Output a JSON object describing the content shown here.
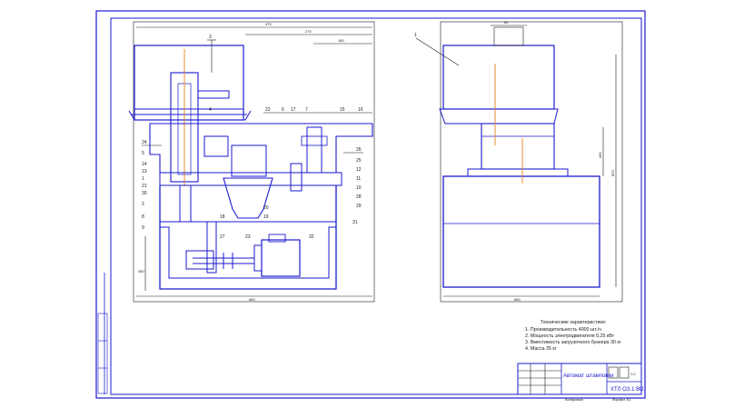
{
  "drawing": {
    "front_view": {
      "dimensions": {
        "top_total": "470",
        "top_mid": "270",
        "top_right": "180",
        "bottom_width": "660",
        "left_height": "360"
      },
      "part_numbers": [
        "3",
        "4",
        "22",
        "6",
        "17",
        "7",
        "15",
        "16",
        "24",
        "23",
        "5",
        "14",
        "13",
        "1",
        "21",
        "30",
        "2",
        "8",
        "9",
        "10",
        "11",
        "12",
        "18",
        "19",
        "20",
        "25",
        "26",
        "27",
        "28",
        "29",
        "31",
        "32"
      ],
      "callouts": [
        "1",
        "2",
        "3",
        "4",
        "5",
        "6",
        "7",
        "8",
        "9",
        "10",
        "11",
        "12",
        "13",
        "14",
        "15",
        "16",
        "17",
        "18",
        "19",
        "20",
        "21",
        "22",
        "23",
        "24",
        "25",
        "26",
        "27",
        "28",
        "29",
        "30",
        "31",
        "32"
      ]
    },
    "side_view": {
      "dimensions": {
        "top": "60",
        "bottom_width": "660",
        "right_height_a": "820",
        "right_height_b": "460"
      },
      "callout": "1"
    },
    "notes": {
      "heading": "Технические характеристики:",
      "items": [
        "1. Производительность 4000 шт./ч.",
        "2. Мощность электродвигателя 0,25 кВт",
        "3. Вместимость загрузочного бункера 30 кг",
        "4. Масса 35 кг"
      ]
    },
    "title_block": {
      "name": "Автомат штамповки",
      "code": "ХТЛ ОЗ.1 ВО",
      "scale": "1:2",
      "sheet_label": "Лист",
      "format": "Формат А1",
      "copied": "Копировал"
    },
    "colors": {
      "outline": "#1a1ad0",
      "axis": "#e08020",
      "ink": "#1a1a1a"
    }
  }
}
